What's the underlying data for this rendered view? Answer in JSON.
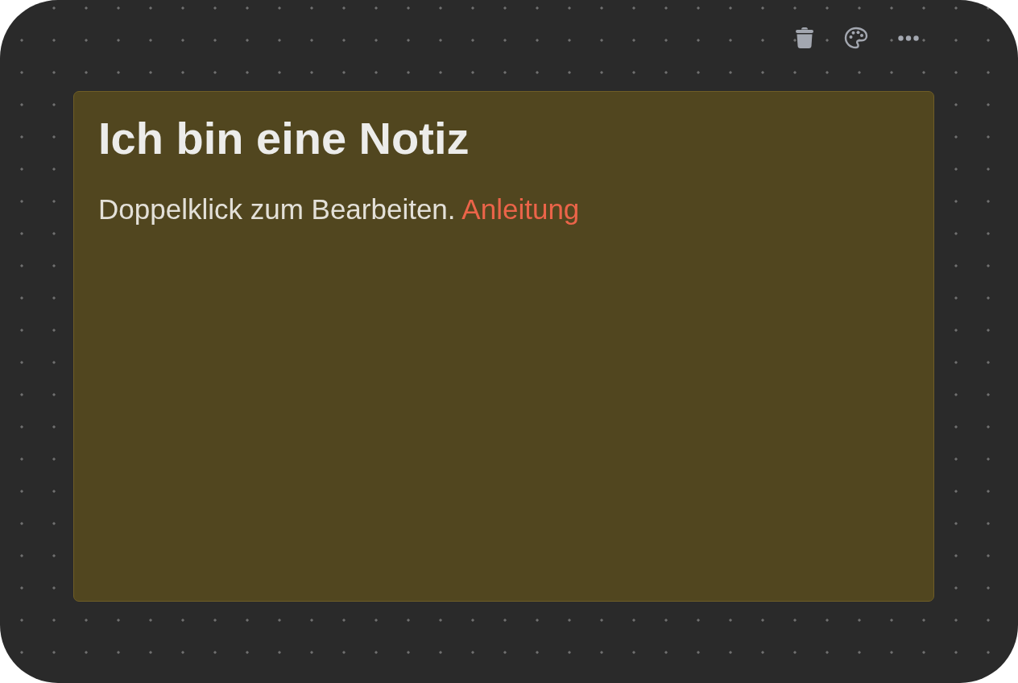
{
  "note": {
    "title": "Ich bin eine Notiz",
    "body": "Doppelklick zum Bearbeiten.",
    "link": "Anleitung"
  }
}
